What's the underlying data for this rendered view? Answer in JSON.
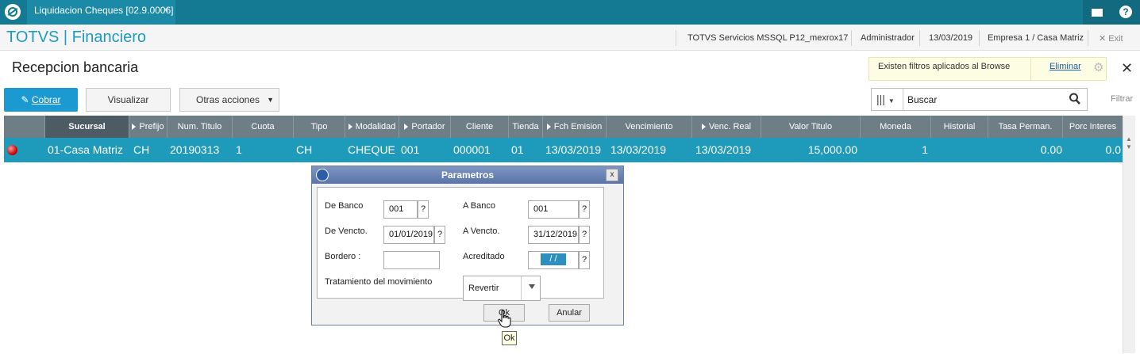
{
  "topbar": {
    "tab_title": "Liquidacion Cheques [02.9.0006]",
    "tab_close": "×"
  },
  "header": {
    "brand": "TOTVS | Financiero",
    "server": "TOTVS Servicios MSSQL P12_mexrox17",
    "user": "Administrador",
    "date": "13/03/2019",
    "company": "Empresa 1 / Casa Matriz",
    "exit_label": "Exit"
  },
  "page": {
    "title": "Recepcion bancaria",
    "filter_notice": "Existen filtros aplicados al Browse",
    "filter_clear": "Eliminar"
  },
  "toolbar": {
    "cobrar_label": "Cobrar",
    "visualizar_label": "Visualizar",
    "otras_label": "Otras acciones",
    "search_value": "Buscar",
    "filter_label": "Filtrar"
  },
  "grid": {
    "columns": [
      "Sucursal",
      "Prefijo",
      "Num. Titulo",
      "Cuota",
      "Tipo",
      "Modalidad",
      "Portador",
      "Cliente",
      "Tienda",
      "Fch Emision",
      "Vencimiento",
      "Venc. Real",
      "Valor Titulo",
      "Moneda",
      "Historial",
      "Tasa Perman.",
      "Porc Interes"
    ],
    "row": {
      "sucursal": "01-Casa Matriz",
      "prefijo": "CH",
      "num_titulo": "20190313",
      "cuota": "1",
      "tipo": "CH",
      "modalidad": "CHEQUE",
      "portador": "001",
      "cliente": "000001",
      "tienda": "01",
      "fch_emision": "13/03/2019",
      "vencimiento": "13/03/2019",
      "venc_real": "13/03/2019",
      "valor_titulo": "15,000.00",
      "moneda": "1",
      "historial": "",
      "tasa_perman": "0.00",
      "porc_interes": "0.0"
    }
  },
  "dialog": {
    "title": "Parametros",
    "close": "x",
    "de_banco_label": "De Banco",
    "de_banco_value": "001",
    "a_banco_label": "A  Banco",
    "a_banco_value": "001",
    "de_vencto_label": "De Vencto.",
    "de_vencto_value": "01/01/2019",
    "a_vencto_label": "A  Vencto.",
    "a_vencto_value": "31/12/2019",
    "bordero_label": "Bordero :",
    "bordero_value": "",
    "acreditado_label": "Acreditado",
    "acreditado_value": "/  /",
    "tratamiento_label": "Tratamiento del movimiento",
    "tratamiento_value": "Revertir",
    "lookup": "?",
    "ok_label": "Ok",
    "anular_label": "Anular",
    "tooltip": "Ok"
  }
}
